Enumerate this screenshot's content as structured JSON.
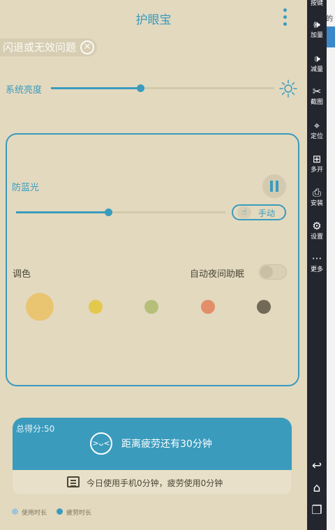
{
  "app": {
    "title": "护眼宝",
    "toast": "闪退或无效问题",
    "brightness": {
      "label": "系统亮度",
      "value_fraction": 0.4
    },
    "bluelight": {
      "label": "防蓝光",
      "value_fraction": 0.44,
      "mode_label": "手动"
    },
    "tone": {
      "label": "调色",
      "night_label": "自动夜间助眠",
      "swatches": [
        "#e9c572",
        "#e3c84e",
        "#b6bf79",
        "#e28e68",
        "#726a57"
      ]
    },
    "score": {
      "label": "总得分:50",
      "fatigue_text": "距离疲劳还有30分钟",
      "usage_text": "今日使用手机0分钟，疲劳使用0分钟"
    },
    "legend": [
      {
        "label": "使用时长",
        "color": "#9fc6d6"
      },
      {
        "label": "疲劳时长",
        "color": "#3a9bbd"
      }
    ],
    "accent": "#3a9bbd",
    "background": "#e3d9bf"
  },
  "toolbar": {
    "items": [
      {
        "icon": "key-icon",
        "label": "按键"
      },
      {
        "icon": "volume-up-icon",
        "label": "加量"
      },
      {
        "icon": "volume-down-icon",
        "label": "减量"
      },
      {
        "icon": "scissors-icon",
        "label": "截图"
      },
      {
        "icon": "location-pin-icon",
        "label": "定位"
      },
      {
        "icon": "multi-window-icon",
        "label": "多开"
      },
      {
        "icon": "apk-install-icon",
        "label": "安装"
      },
      {
        "icon": "gear-icon",
        "label": "设置"
      },
      {
        "icon": "more-icon",
        "label": "更多"
      }
    ],
    "nav": [
      {
        "icon": "back-icon"
      },
      {
        "icon": "home-icon"
      },
      {
        "icon": "recent-apps-icon"
      }
    ]
  },
  "background_app": {
    "text": "的"
  }
}
